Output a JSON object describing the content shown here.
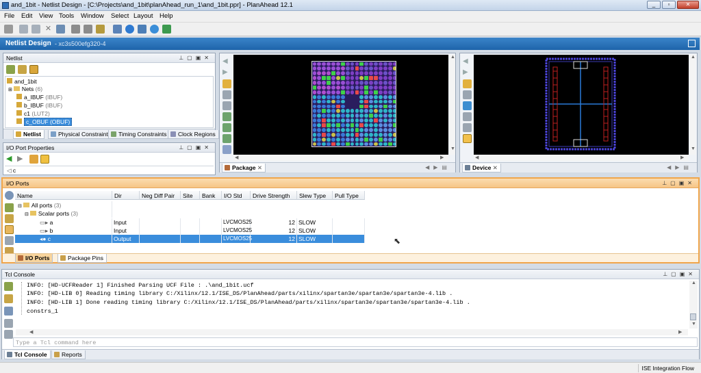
{
  "window": {
    "title": "and_1bit - Netlist Design - [C:\\Projects\\and_1bit\\planAhead_run_1\\and_1bit.ppr] - PlanAhead 12.1"
  },
  "menu": [
    "File",
    "Edit",
    "View",
    "Tools",
    "Window",
    "Select",
    "Layout",
    "Help"
  ],
  "header": {
    "title": "Netlist Design",
    "device": "- xc3s500efg320-4"
  },
  "netlist": {
    "title": "Netlist",
    "tree": [
      {
        "label": "and_1bit",
        "note": ""
      },
      {
        "label": "Nets",
        "note": "(6)"
      },
      {
        "label": "a_IBUF",
        "note": "(IBUF)"
      },
      {
        "label": "b_IBUF",
        "note": "(IBUF)"
      },
      {
        "label": "c1",
        "note": "(LUT2)"
      },
      {
        "label": "c_OBUF (OBUF)",
        "note": ""
      }
    ],
    "tabs": [
      "Netlist",
      "Physical Constraints",
      "Timing Constraints",
      "Clock Regions"
    ]
  },
  "props": {
    "title": "I/O Port Properties",
    "search_value": "c"
  },
  "views": {
    "package_tab": "Package",
    "device_tab": "Device"
  },
  "ioports": {
    "title": "I/O Ports",
    "columns": [
      "Name",
      "Dir",
      "Neg Diff Pair",
      "Site",
      "Bank",
      "I/O Std",
      "Drive Strength",
      "Slew Type",
      "Pull Type"
    ],
    "groups": [
      {
        "label": "All ports",
        "count": "(3)"
      },
      {
        "label": "Scalar ports",
        "count": "(3)"
      }
    ],
    "rows": [
      {
        "name": "a",
        "dir": "Input",
        "std": "LVCMOS25",
        "drive": "12",
        "slew": "SLOW"
      },
      {
        "name": "b",
        "dir": "Input",
        "std": "LVCMOS25",
        "drive": "12",
        "slew": "SLOW"
      },
      {
        "name": "c",
        "dir": "Output",
        "std": "LVCMOS25",
        "drive": "12",
        "slew": "SLOW"
      }
    ],
    "tabs": [
      "I/O Ports",
      "Package Pins"
    ]
  },
  "tcl": {
    "title": "Tcl Console",
    "lines": [
      "INFO: [HD-UCFReader 1] Finished Parsing UCF File : .\\and_1bit.ucf",
      "INFO: [HD-LIB 0] Reading timing library C:/Xilinx/12.1/ISE_DS/PlanAhead/parts/xilinx/spartan3e/spartan3e/spartan3e-4.lib .",
      "INFO: [HD-LIB 1] Done reading timing library C:/Xilinx/12.1/ISE_DS/PlanAhead/parts/xilinx/spartan3e/spartan3e/spartan3e-4.lib .",
      "constrs_1"
    ],
    "placeholder": "Type a Tcl command here",
    "tabs": [
      "Tcl Console",
      "Reports"
    ]
  },
  "status": {
    "flow": "ISE Integration Flow"
  },
  "colors": {
    "accent": "#1e64aa",
    "selection": "#3a8ddc",
    "ioheader": "#f7c98b"
  }
}
